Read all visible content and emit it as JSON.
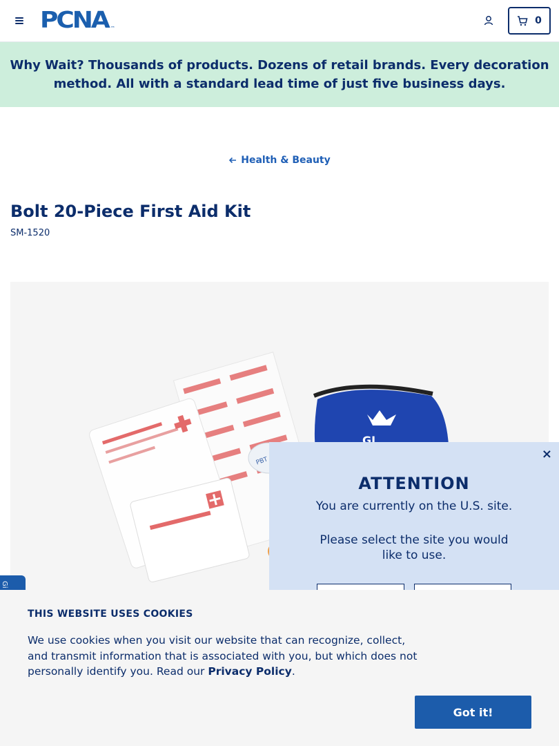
{
  "header": {
    "logo_text": "PCNA",
    "logo_tm": "™",
    "cart_count": "0"
  },
  "banner": {
    "lead": "Why Wait?",
    "text": " Thousands of products. Dozens of retail brands. Every decoration method. All with a standard lead time of just five business days."
  },
  "breadcrumb": {
    "label": "Health & Beauty"
  },
  "product": {
    "title": "Bolt 20-Piece First Aid Kit",
    "sku": "SM-1520",
    "image_alt": "Bolt 20-Piece First Aid Kit contents"
  },
  "side_tab": {
    "label": "Gi"
  },
  "attention": {
    "close": "×",
    "title": "ATTENTION",
    "text": "You are currently on the U.S. site.",
    "select_text": "Please select the site you would like to use."
  },
  "cookie": {
    "title": "THIS WEBSITE USES COOKIES",
    "text": "We use cookies when you visit our website that can recognize, collect, and transmit information that is associated with you, but which does not personally identify you. Read our ",
    "link": "Privacy Policy",
    "end": ".",
    "button": "Got it!"
  },
  "colors": {
    "navy": "#0c2d6b",
    "brand_blue": "#1c5cab",
    "banner_green": "#cdeedc",
    "modal_blue": "#d4e1f4"
  },
  "icons": [
    "hamburger-menu-icon",
    "user-icon",
    "cart-icon",
    "arrow-left-icon",
    "close-icon"
  ]
}
